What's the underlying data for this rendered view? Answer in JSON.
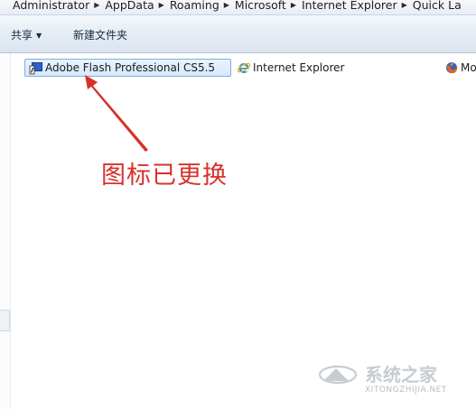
{
  "breadcrumb": {
    "items": [
      "Administrator",
      "AppData",
      "Roaming",
      "Microsoft",
      "Internet Explorer",
      "Quick La"
    ],
    "separator": "▶"
  },
  "toolbar": {
    "share_label": "共享",
    "share_arrow": "▼",
    "new_folder_label": "新建文件夹"
  },
  "files": [
    {
      "name": "Adobe Flash Professional CS5.5",
      "icon": "flash-app-icon",
      "selected": true
    },
    {
      "name": "Internet Explorer",
      "icon": "internet-explorer-icon",
      "selected": false
    },
    {
      "name": "Mo",
      "icon": "firefox-icon",
      "selected": false
    }
  ],
  "annotation": {
    "caption": "图标已更换",
    "color": "#d8312b"
  },
  "watermark": {
    "text": "系统之家",
    "url": "XITONGZHIJIA.NET"
  },
  "colors": {
    "selection_bg": "#d7e9fb",
    "selection_border": "#84acdd",
    "toolbar_bg": "#e4ebf4"
  }
}
